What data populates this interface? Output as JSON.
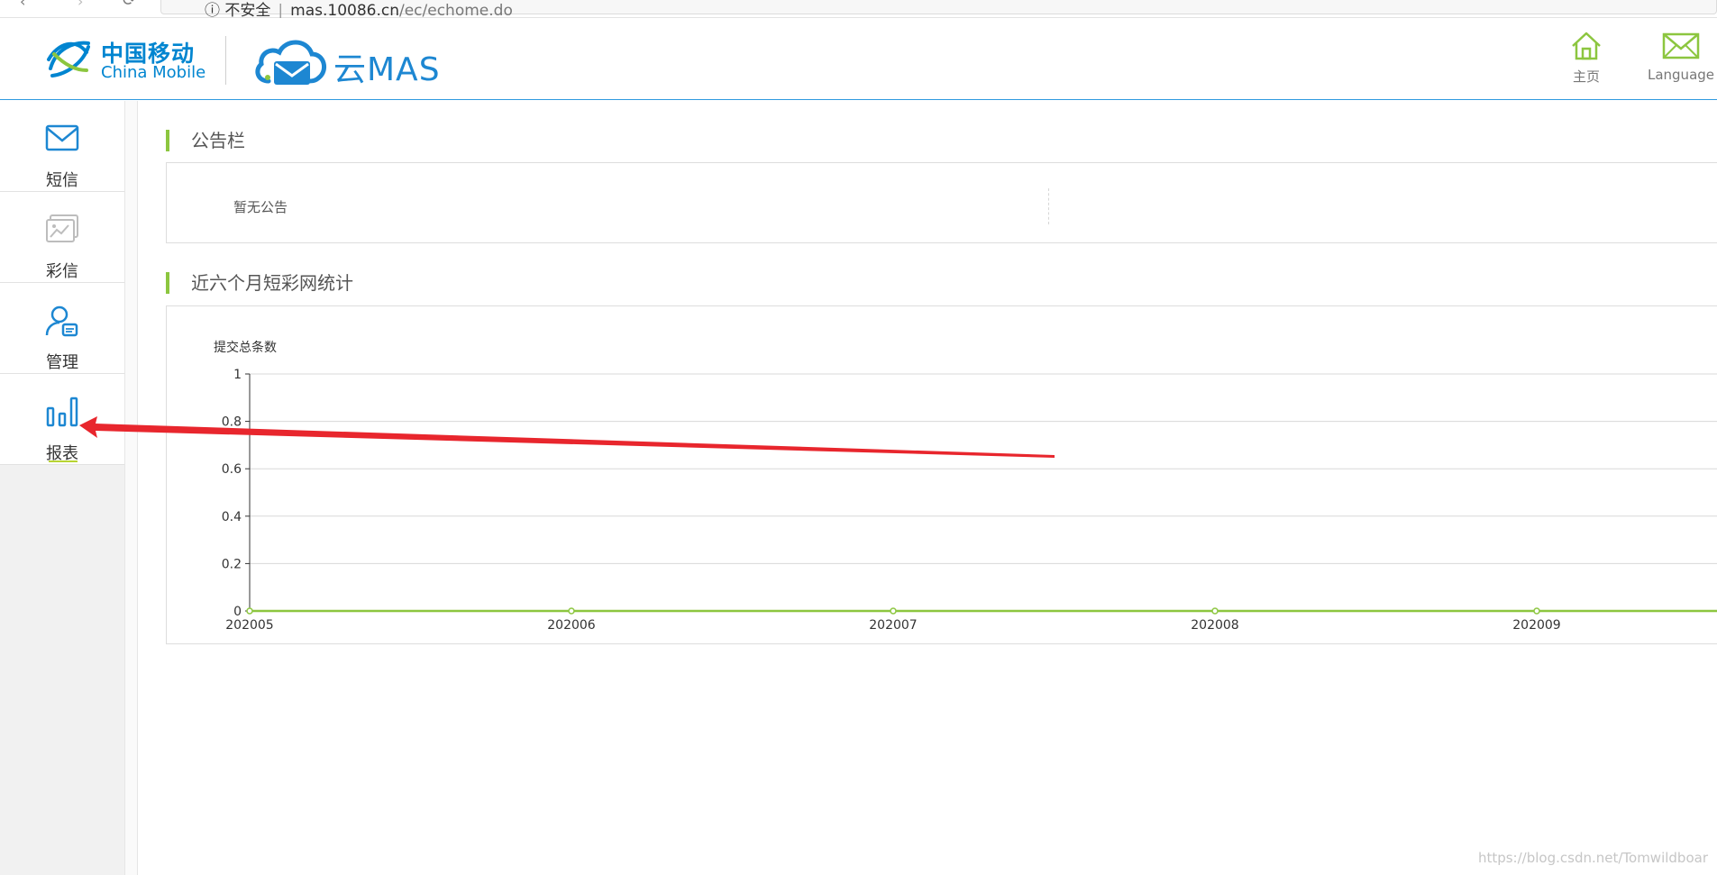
{
  "browser": {
    "back_glyph": "‹",
    "forward_glyph": "›",
    "security_label": "不安全",
    "url_host": "mas.10086.cn",
    "url_path": "/ec/echome.do"
  },
  "header": {
    "logo_cn": "中国移动",
    "logo_en": "China Mobile",
    "product_name": "云MAS",
    "links": [
      {
        "label": "主页",
        "icon": "home-icon"
      },
      {
        "label": "Language",
        "icon": "envelope-icon"
      }
    ]
  },
  "sidebar": {
    "items": [
      {
        "label": "短信",
        "icon": "mail-icon"
      },
      {
        "label": "彩信",
        "icon": "image-icon"
      },
      {
        "label": "管理",
        "icon": "user-card-icon"
      },
      {
        "label": "报表",
        "icon": "bar-chart-icon",
        "active": true
      }
    ]
  },
  "notice": {
    "title": "公告栏",
    "empty_text": "暂无公告"
  },
  "stats": {
    "title": "近六个月短彩网统计"
  },
  "chart_data": {
    "type": "line",
    "title": "",
    "ylabel": "提交总条数",
    "xlabel": "",
    "categories": [
      "202005",
      "202006",
      "202007",
      "202008",
      "202009"
    ],
    "series": [
      {
        "values": [
          0,
          0,
          0,
          0,
          0
        ],
        "color": "#8cc63f"
      }
    ],
    "ylim": [
      0,
      1
    ],
    "y_ticks": [
      "0",
      "0.2",
      "0.4",
      "0.6",
      "0.8",
      "1"
    ],
    "grid": true
  },
  "colors": {
    "accent_green": "#8cc63f",
    "brand_blue": "#0085d0",
    "annotation_red": "#e8262d"
  },
  "watermark": "https://blog.csdn.net/Tomwildboar"
}
